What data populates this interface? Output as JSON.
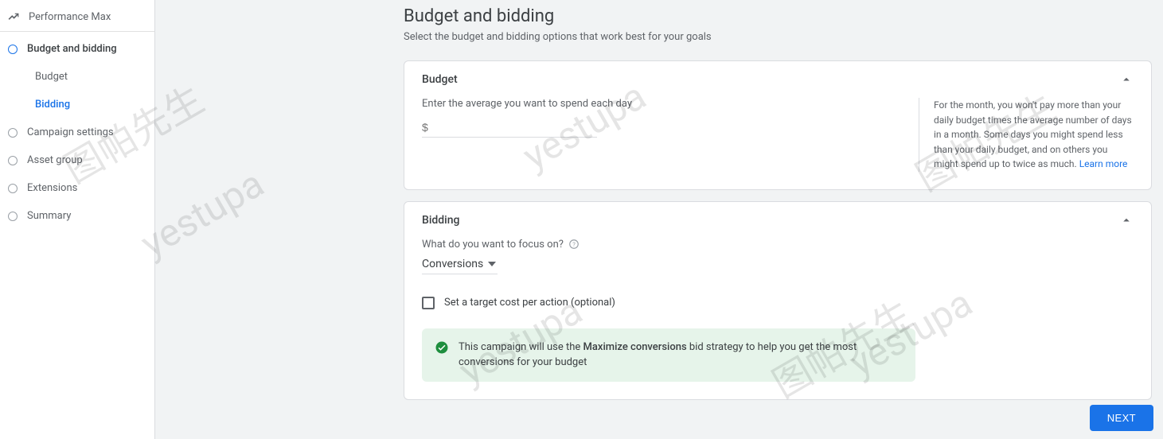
{
  "sidebar": {
    "top": "Performance Max",
    "items": [
      {
        "label": "Budget and bidding",
        "current": true
      },
      {
        "label": "Campaign settings"
      },
      {
        "label": "Asset group"
      },
      {
        "label": "Extensions"
      },
      {
        "label": "Summary"
      }
    ],
    "subs": [
      {
        "label": "Budget"
      },
      {
        "label": "Bidding",
        "active": true
      }
    ]
  },
  "page": {
    "title": "Budget and bidding",
    "subtitle": "Select the budget and bidding options that work best for your goals"
  },
  "budget": {
    "card_title": "Budget",
    "field_label": "Enter the average you want to spend each day",
    "placeholder": "$",
    "side_note": "For the month, you won't pay more than your daily budget times the average number of days in a month. Some days you might spend less than your daily budget, and on others you might spend up to twice as much.",
    "learn_more": "Learn more"
  },
  "bidding": {
    "card_title": "Bidding",
    "focus_label": "What do you want to focus on?",
    "focus_value": "Conversions",
    "checkbox_label": "Set a target cost per action (optional)",
    "banner_pre": "This campaign will use the ",
    "banner_bold": "Maximize conversions",
    "banner_post": " bid strategy to help you get the most conversions for your budget"
  },
  "footer": {
    "next": "NEXT"
  },
  "watermarks": {
    "cn": "图帕先生",
    "en": "yestupa"
  }
}
